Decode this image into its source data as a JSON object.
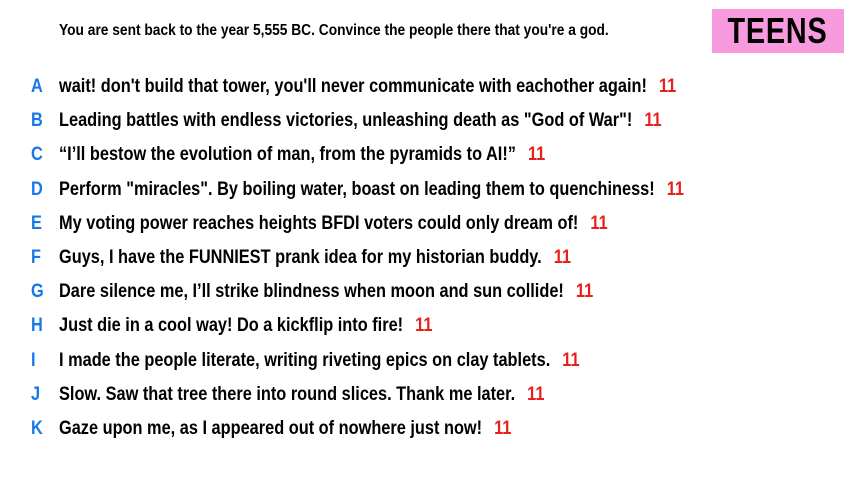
{
  "prompt": "You are sent back to the year 5,555 BC. Convince the people there that you're a god.",
  "badge": "TEENS",
  "colors": {
    "letter": "#1878e8",
    "score": "#e8201c",
    "badge_bg": "#f79bde"
  },
  "entries": [
    {
      "letter": "A",
      "text": "wait! don't build that tower, you'll never communicate with eachother again!",
      "score": "11"
    },
    {
      "letter": "B",
      "text": "Leading battles with endless victories, unleashing death as \"God of War\"!",
      "score": "11"
    },
    {
      "letter": "C",
      "text": "“I’ll bestow the evolution of man, from the pyramids to AI!”",
      "score": "11"
    },
    {
      "letter": "D",
      "text": "Perform \"miracles\". By boiling water, boast on leading them to quenchiness!",
      "score": "11"
    },
    {
      "letter": "E",
      "text": "My voting power reaches heights BFDI voters could only dream of!",
      "score": "11"
    },
    {
      "letter": "F",
      "text": "Guys, I have the FUNNIEST prank idea for my historian buddy.",
      "score": "11"
    },
    {
      "letter": "G",
      "text": "Dare silence me, I’ll strike blindness when moon and sun collide!",
      "score": "11"
    },
    {
      "letter": "H",
      "text": "Just die in a cool way! Do a kickflip into fire!",
      "score": "11"
    },
    {
      "letter": "I",
      "text": "I made the people literate, writing riveting epics on clay tablets.",
      "score": "11"
    },
    {
      "letter": "J",
      "text": "Slow. Saw that tree there into round slices. Thank me later.",
      "score": "11"
    },
    {
      "letter": "K",
      "text": "Gaze upon me, as I appeared out of nowhere just now!",
      "score": "11"
    }
  ]
}
